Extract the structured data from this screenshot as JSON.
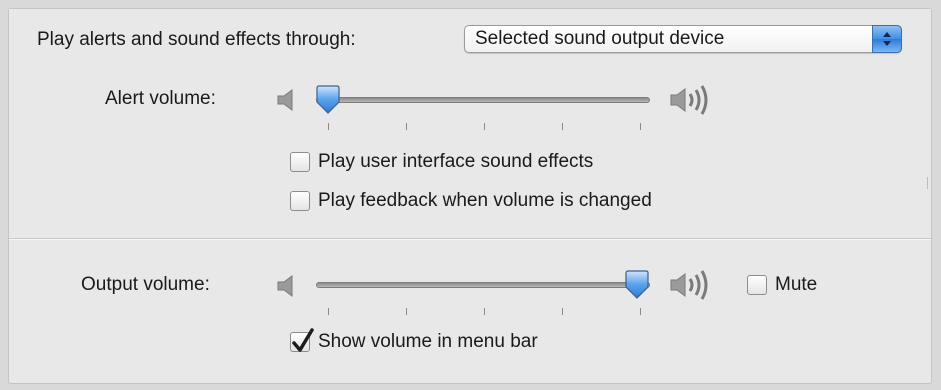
{
  "alerts_output": {
    "label": "Play alerts and sound effects through:",
    "selected": "Selected sound output device"
  },
  "alert_volume": {
    "label": "Alert volume:",
    "level": 0.03
  },
  "ui_sound_effects": {
    "label": "Play user interface sound effects",
    "checked": false
  },
  "volume_feedback": {
    "label": "Play feedback when volume is changed",
    "checked": false
  },
  "output_volume": {
    "label": "Output volume:",
    "level": 1.0
  },
  "mute": {
    "label": "Mute",
    "checked": false
  },
  "show_volume_menu_bar": {
    "label": "Show volume in menu bar",
    "checked": true
  },
  "colors": {
    "accent": "#3f8ee4",
    "background": "#e8e8e8"
  },
  "icons": {
    "volume_low": "speaker-low-icon",
    "volume_high": "speaker-high-icon",
    "popup_arrows": "up-down-arrows-icon",
    "checkmark": "checkmark-icon"
  }
}
